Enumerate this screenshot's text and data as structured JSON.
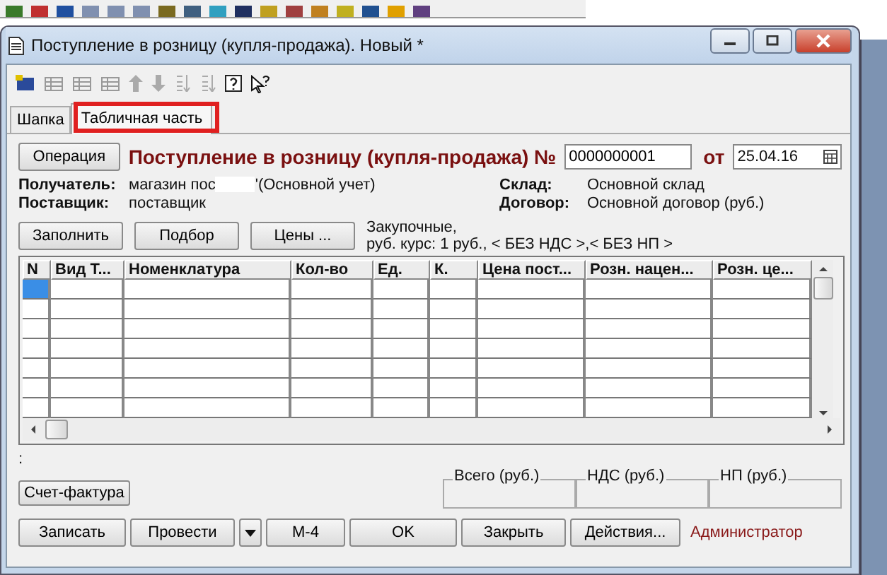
{
  "window": {
    "title": "Поступление в розницу (купля-продажа). Новый *"
  },
  "tabs": [
    {
      "label": "Шапка",
      "selected": false
    },
    {
      "label": "Табличная часть",
      "selected": true
    }
  ],
  "header": {
    "operation_button": "Операция",
    "doc_title": "Поступление в розницу (купля-продажа) №",
    "number": "0000000001",
    "date_label": "от",
    "date": "25.04.16"
  },
  "fields": {
    "recipient_label": "Получатель:",
    "recipient_value": "магазин пос",
    "recipient_suffix": "'(Основной учет)",
    "supplier_label": "Поставщик:",
    "supplier_value": "поставщик",
    "warehouse_label": "Склад:",
    "warehouse_value": "Основной склад",
    "contract_label": "Договор:",
    "contract_value": "Основной договор (руб.)"
  },
  "actions": [
    "Заполнить",
    "Подбор",
    "Цены ..."
  ],
  "price_info": [
    "Закупочные,",
    "руб. курс: 1 руб., < БЕЗ НДС >,< БЕЗ НП >"
  ],
  "table": {
    "columns": [
      "N",
      "Вид Т...",
      "Номенклатура",
      "Кол-во",
      "Ед.",
      "К.",
      "Цена пост...",
      "Розн. нацен...",
      "Розн. це..."
    ],
    "rows": [
      {
        "selected": true
      },
      {
        "selected": false
      },
      {
        "selected": false
      },
      {
        "selected": false
      },
      {
        "selected": false
      },
      {
        "selected": false
      },
      {
        "selected": false
      }
    ]
  },
  "colon": ":",
  "invoice_button": "Счет-фактура",
  "totals": [
    "Всего (руб.)",
    "НДС (руб.)",
    "НП (руб.)"
  ],
  "buttons": [
    "Записать",
    "Провести",
    "М-4",
    "OK",
    "Закрыть",
    "Действия..."
  ],
  "user": "Администратор"
}
